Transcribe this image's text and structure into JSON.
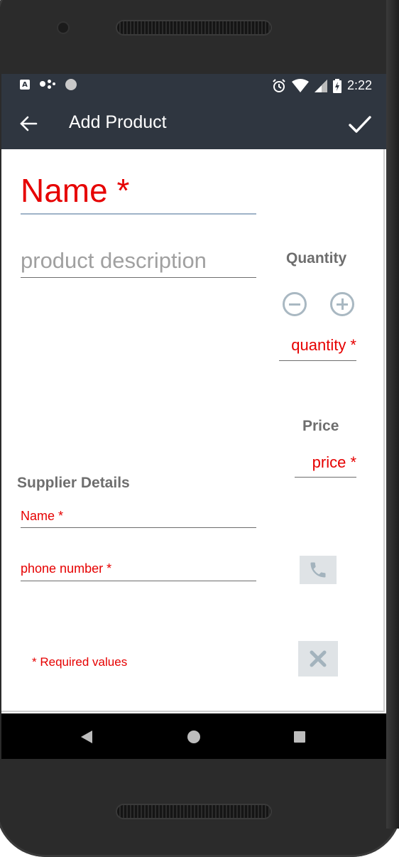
{
  "status_bar": {
    "time": "2:22",
    "left_icons": [
      "a-notification-icon",
      "assistant-dots-icon",
      "circle-indicator-icon"
    ],
    "right_icons": [
      "alarm-icon",
      "wifi-icon",
      "cell-signal-icon",
      "battery-charging-icon"
    ]
  },
  "app_bar": {
    "title": "Add Product",
    "back_icon": "arrow-left-icon",
    "save_icon": "check-icon"
  },
  "form": {
    "name_placeholder": "Name *",
    "description_placeholder": "product description",
    "quantity_label": "Quantity",
    "quantity_placeholder": "quantity *",
    "price_label": "Price",
    "price_placeholder": "price *",
    "supplier_label": "Supplier Details",
    "supplier_name_placeholder": "Name *",
    "supplier_phone_placeholder": "phone number *",
    "required_note": "* Required values"
  },
  "nav_bar": {
    "icons": [
      "nav-back-icon",
      "nav-home-icon",
      "nav-recent-icon"
    ]
  },
  "colors": {
    "app_bar": "#2f3640",
    "required_red": "#e60000",
    "label_gray": "#6e6e6e",
    "control_gray": "#a9b8c2",
    "button_bg": "#dfe3e6"
  }
}
